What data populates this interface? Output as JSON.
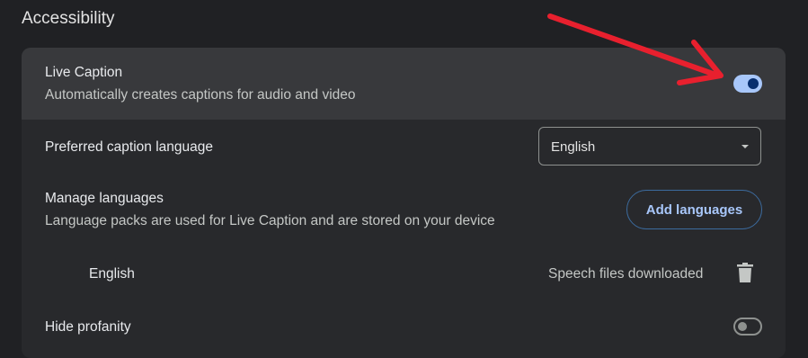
{
  "section": {
    "title": "Accessibility"
  },
  "live_caption": {
    "title": "Live Caption",
    "subtitle": "Automatically creates captions for audio and video",
    "enabled": true
  },
  "caption_language": {
    "label": "Preferred caption language",
    "selected": "English"
  },
  "manage_languages": {
    "title": "Manage languages",
    "subtitle": "Language packs are used for Live Caption and are stored on your device",
    "button_label": "Add languages"
  },
  "language_pack": {
    "name": "English",
    "status": "Speech files downloaded",
    "remove_icon": "trash-icon"
  },
  "hide_profanity": {
    "label": "Hide profanity",
    "enabled": false
  },
  "colors": {
    "background": "#202124",
    "card": "#28292c",
    "highlight_row": "#38393c",
    "accent": "#a8c7fa",
    "annotation_arrow": "#e8202e"
  }
}
